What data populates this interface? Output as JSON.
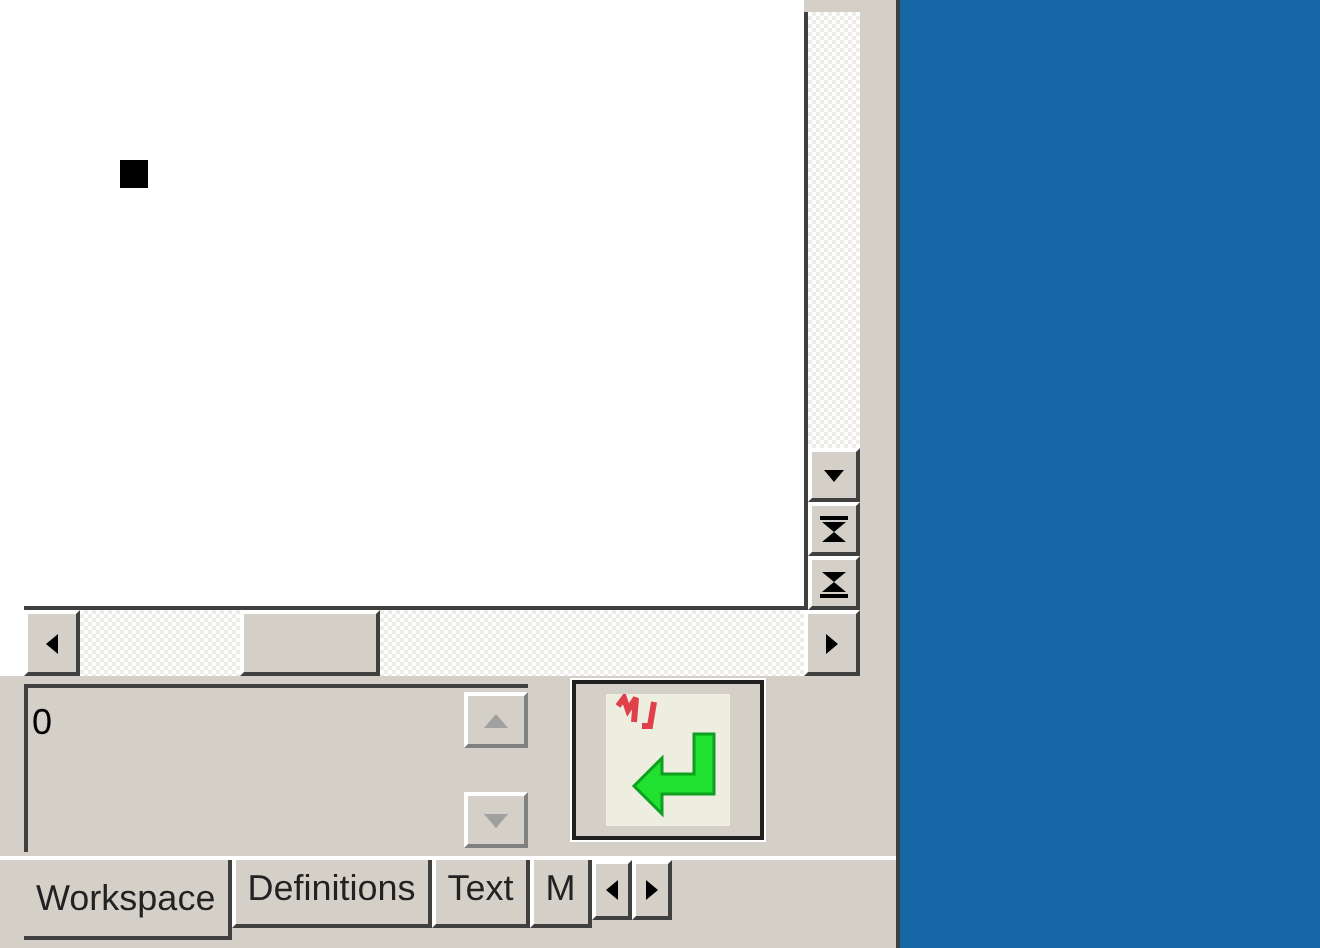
{
  "input": {
    "value": "0"
  },
  "tabs": [
    {
      "label": "Workspace",
      "selected": true
    },
    {
      "label": "Definitions",
      "selected": false
    },
    {
      "label": "Text",
      "selected": false
    },
    {
      "label": "M",
      "selected": false
    }
  ]
}
